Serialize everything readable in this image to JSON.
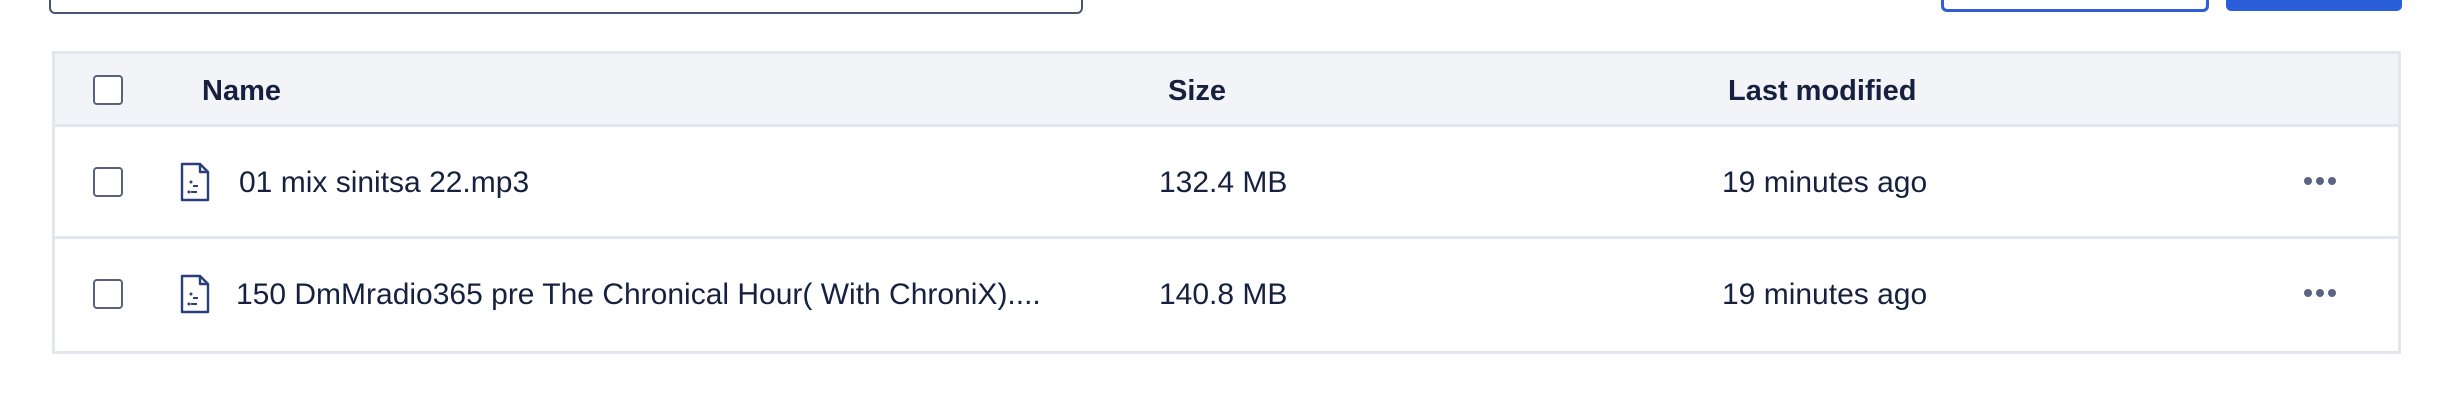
{
  "table": {
    "columns": {
      "name": "Name",
      "size": "Size",
      "modified": "Last modified"
    },
    "rows": [
      {
        "name": "01 mix sinitsa 22.mp3",
        "size": "132.4 MB",
        "modified": "19 minutes ago",
        "icon": "audio-file-icon"
      },
      {
        "name": "150 DmMradio365 pre The Chronical Hour( With ChroniX)....",
        "size": "140.8 MB",
        "modified": "19 minutes ago",
        "icon": "audio-file-icon"
      }
    ]
  },
  "colors": {
    "accent": "#2b5fd9",
    "text": "#17213f",
    "border": "#e4e6ed",
    "header_bg": "#f3f4f8"
  }
}
